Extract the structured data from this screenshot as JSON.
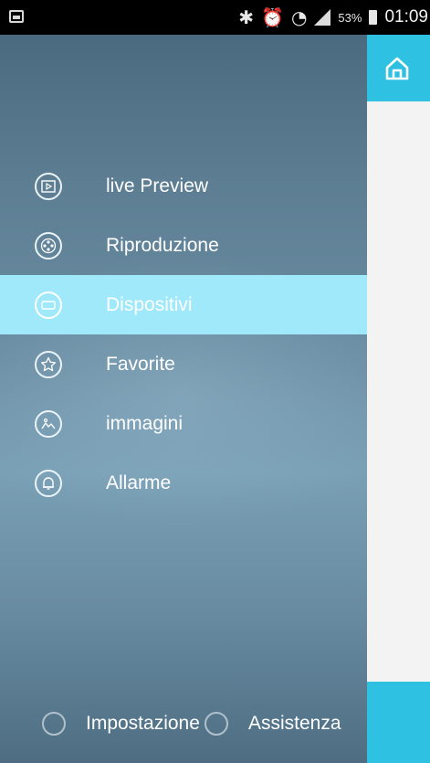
{
  "status_bar": {
    "icons": [
      "bluetooth-icon",
      "alarm-clock-icon",
      "wifi-icon",
      "signal-icon"
    ],
    "battery_percent": "53%",
    "time": "01:09"
  },
  "drawer": {
    "menu": [
      {
        "label": "live Preview",
        "icon": "video-player-icon",
        "active": false
      },
      {
        "label": "Riproduzione",
        "icon": "film-reel-icon",
        "active": false
      },
      {
        "label": "Dispositivi",
        "icon": "device-icon",
        "active": true
      },
      {
        "label": "Favorite",
        "icon": "star-icon",
        "active": false
      },
      {
        "label": "immagini",
        "icon": "image-icon",
        "active": false
      },
      {
        "label": "Allarme",
        "icon": "bell-icon",
        "active": false
      }
    ],
    "footer": {
      "settings_label": "Impostazione",
      "help_label": "Assistenza"
    }
  },
  "main": {
    "home_icon": "home-icon"
  },
  "colors": {
    "accent": "#2ec1e2",
    "active_item": "#9fe9fa",
    "drawer_bg": "#6a8ca2"
  }
}
